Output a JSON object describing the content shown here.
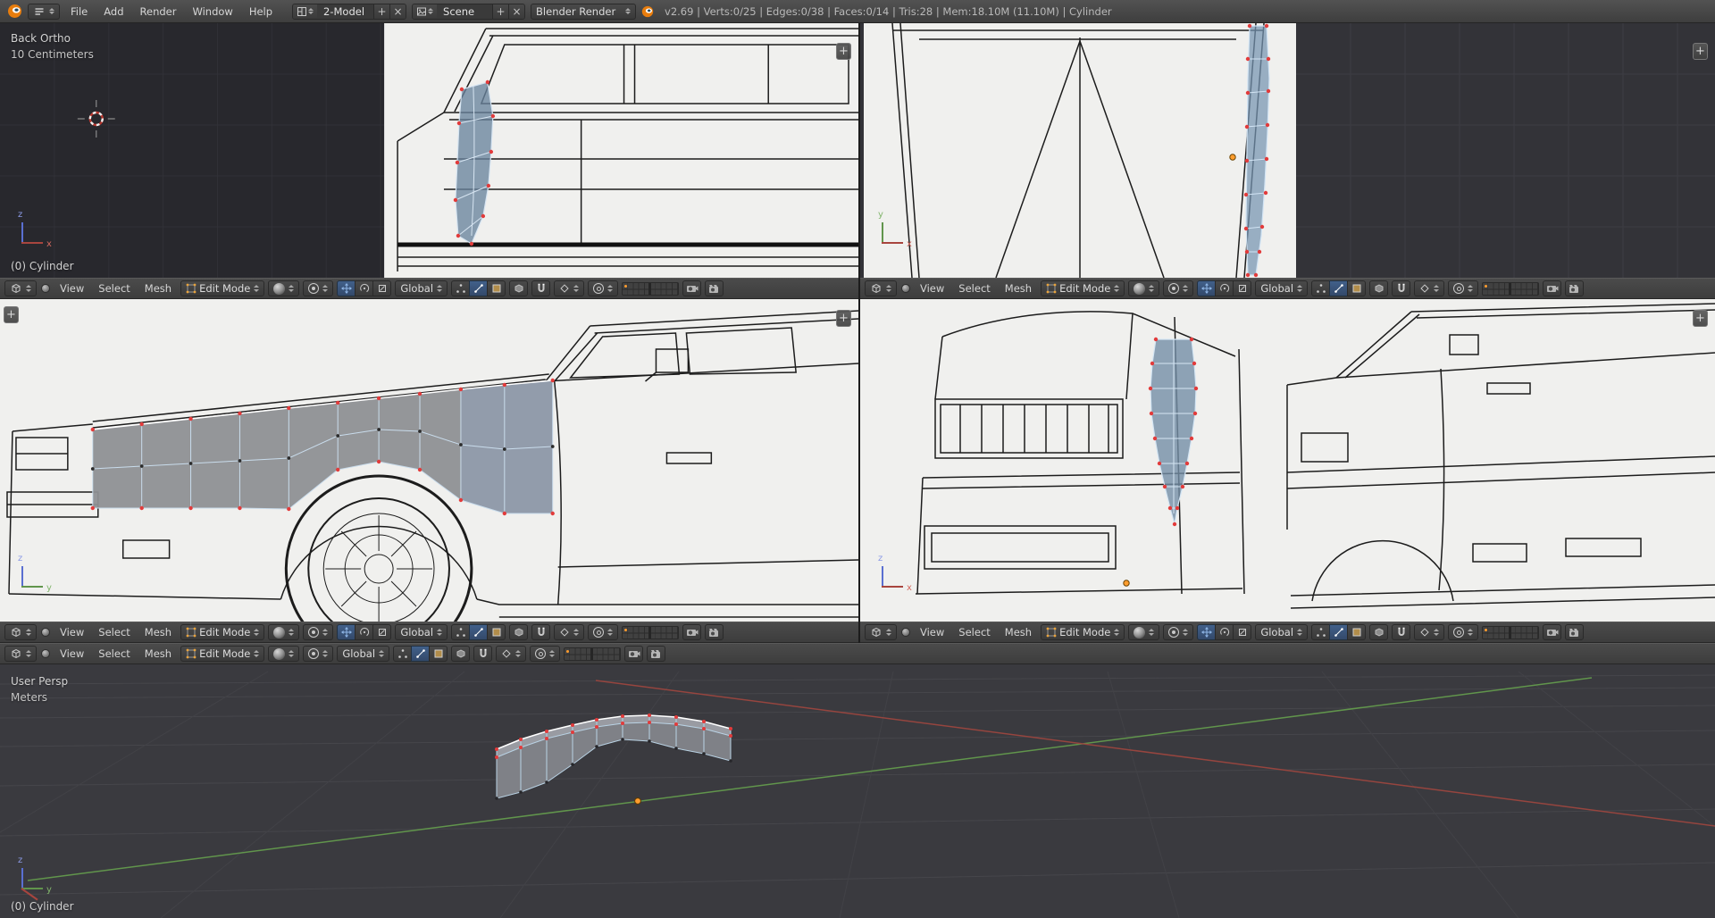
{
  "info_bar": {
    "menus": {
      "file": "File",
      "add": "Add",
      "render": "Render",
      "window": "Window",
      "help": "Help"
    },
    "screen_layout": {
      "value": "2-Model",
      "add_label": "+",
      "close_label": "×"
    },
    "scene": {
      "value": "Scene",
      "add_label": "+",
      "close_label": "×"
    },
    "engine": "Blender Render",
    "stats": "v2.69 | Verts:0/25 | Edges:0/38 | Faces:0/14 | Tris:28 | Mem:18.10M (11.10M) | Cylinder"
  },
  "view_header": {
    "menus": {
      "view": "View",
      "select": "Select",
      "mesh": "Mesh"
    },
    "mode": "Edit Mode",
    "orientation": "Global"
  },
  "viewports": {
    "back_ortho": {
      "view_label": "Back Ortho",
      "grid_label": "10 Centimeters",
      "object_label": "(0) Cylinder",
      "axes": {
        "v": "z",
        "h": "x"
      }
    },
    "top_ortho": {
      "axes": {
        "v": "y",
        "h": "x"
      }
    },
    "side_ortho": {
      "axes": {
        "v": "z",
        "h": "y"
      }
    },
    "rear_ortho": {
      "axes": {
        "v": "z",
        "h": "x"
      }
    },
    "perspective": {
      "view_label": "User Persp",
      "grid_label": "Meters",
      "object_label": "(0) Cylinder",
      "axes": {
        "v": "z",
        "h": "y"
      }
    }
  },
  "icons": {
    "panel_toggle": "+"
  },
  "colors": {
    "header_bg": "#454545",
    "viewport_bg": "#2b2b2f",
    "blueprint_bg": "#f0f0ee",
    "mesh_face": "#8e9094",
    "mesh_edge": "#c9dcec",
    "selected_edge": "#ffffff",
    "vertex": "#dd3b3b",
    "axis_x": "#a8453e",
    "axis_y": "#61954c",
    "axis_z": "#5a6fd1",
    "origin_dot": "#ff9d2e",
    "logo_orange": "#e87d0d",
    "selection_accent": "#41608a"
  }
}
